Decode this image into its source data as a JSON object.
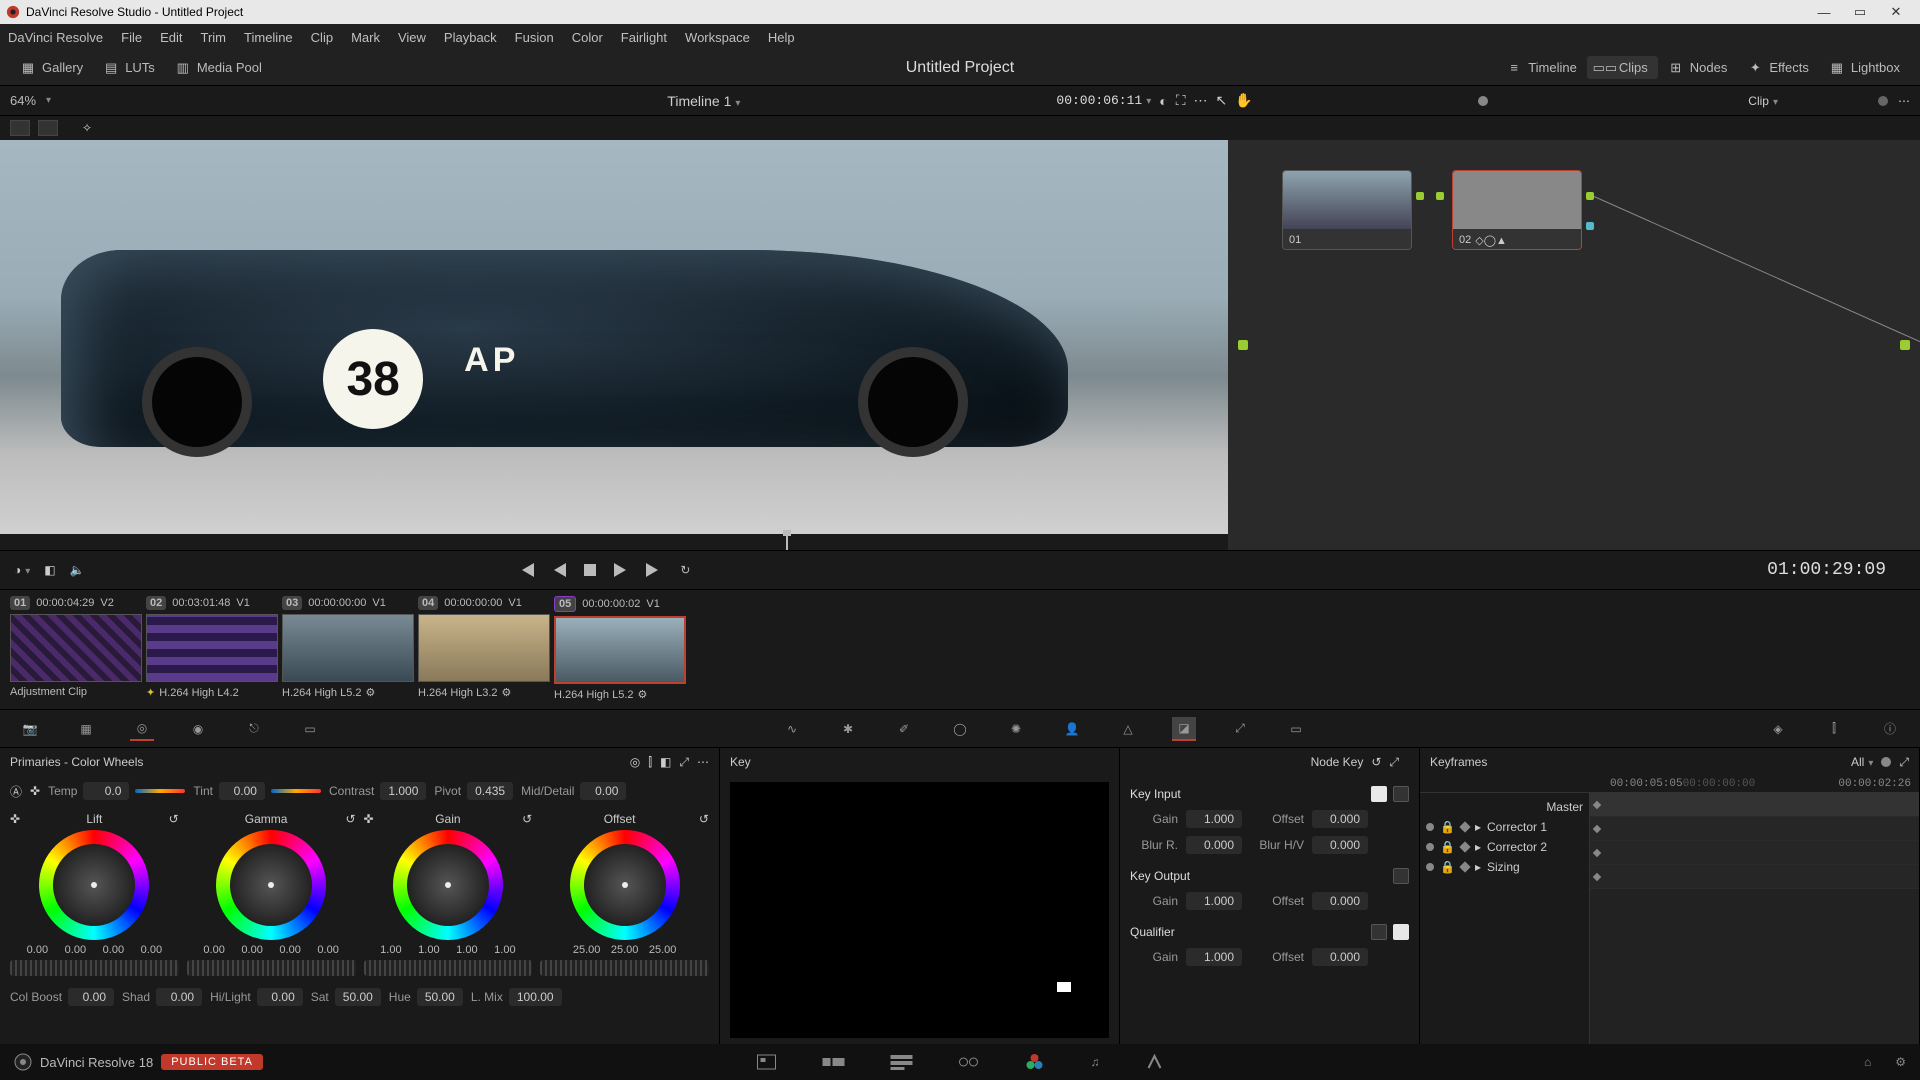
{
  "window": {
    "title": "DaVinci Resolve Studio - Untitled Project"
  },
  "menubar": [
    "DaVinci Resolve",
    "File",
    "Edit",
    "Trim",
    "Timeline",
    "Clip",
    "Mark",
    "View",
    "Playback",
    "Fusion",
    "Color",
    "Fairlight",
    "Workspace",
    "Help"
  ],
  "top": {
    "gallery": "Gallery",
    "luts": "LUTs",
    "mediapool": "Media Pool",
    "project_title": "Untitled Project",
    "timeline_btn": "Timeline",
    "clips_btn": "Clips",
    "nodes_btn": "Nodes",
    "effects_btn": "Effects",
    "lightbox_btn": "Lightbox"
  },
  "sub": {
    "zoom": "64%",
    "timeline_name": "Timeline 1",
    "viewer_tc": "00:00:06:11",
    "clip_mode": "Clip"
  },
  "transport": {
    "record_tc": "01:00:29:09"
  },
  "nodes": {
    "n1": "01",
    "n2": "02"
  },
  "clips": [
    {
      "num": "01",
      "tc": "00:00:04:29",
      "trk": "V2",
      "codec": "Adjustment Clip"
    },
    {
      "num": "02",
      "tc": "00:03:01:48",
      "trk": "V1",
      "codec": "H.264 High L4.2"
    },
    {
      "num": "03",
      "tc": "00:00:00:00",
      "trk": "V1",
      "codec": "H.264 High L5.2"
    },
    {
      "num": "04",
      "tc": "00:00:00:00",
      "trk": "V1",
      "codec": "H.264 High L3.2"
    },
    {
      "num": "05",
      "tc": "00:00:00:02",
      "trk": "V1",
      "codec": "H.264 High L5.2"
    }
  ],
  "primaries": {
    "title": "Primaries - Color Wheels",
    "temp_l": "Temp",
    "temp": "0.0",
    "tint_l": "Tint",
    "tint": "0.00",
    "contrast_l": "Contrast",
    "contrast": "1.000",
    "pivot_l": "Pivot",
    "pivot": "0.435",
    "md_l": "Mid/Detail",
    "md": "0.00",
    "lift": "Lift",
    "gamma": "Gamma",
    "gain": "Gain",
    "offset": "Offset",
    "lift_v": [
      "0.00",
      "0.00",
      "0.00",
      "0.00"
    ],
    "gamma_v": [
      "0.00",
      "0.00",
      "0.00",
      "0.00"
    ],
    "gain_v": [
      "1.00",
      "1.00",
      "1.00",
      "1.00"
    ],
    "offset_v": [
      "25.00",
      "25.00",
      "25.00"
    ],
    "colboost_l": "Col Boost",
    "colboost": "0.00",
    "shad_l": "Shad",
    "shad": "0.00",
    "hl_l": "Hi/Light",
    "hl": "0.00",
    "sat_l": "Sat",
    "sat": "50.00",
    "hue_l": "Hue",
    "hue": "50.00",
    "lmix_l": "L. Mix",
    "lmix": "100.00"
  },
  "key_panel": {
    "title": "Key",
    "node_key": "Node Key",
    "input_title": "Key Input",
    "output_title": "Key Output",
    "qualifier_title": "Qualifier",
    "gain_l": "Gain",
    "offset_l": "Offset",
    "blurr_l": "Blur R.",
    "blurhv_l": "Blur H/V",
    "in_gain": "1.000",
    "in_offset": "0.000",
    "in_blurr": "0.000",
    "in_blurhv": "0.000",
    "out_gain": "1.000",
    "out_offset": "0.000",
    "q_gain": "1.000",
    "q_offset": "0.000"
  },
  "keyframes": {
    "title": "Keyframes",
    "all": "All",
    "tc1": "00:00:05:05",
    "tc2": "00:00:00:00",
    "tc3": "00:00:02:26",
    "master": "Master",
    "c1": "Corrector 1",
    "c2": "Corrector 2",
    "sizing": "Sizing"
  },
  "pagebar": {
    "app_label": "DaVinci Resolve 18",
    "beta": "PUBLIC BETA"
  },
  "viewer_art": {
    "number": "38",
    "ap": "AP"
  }
}
